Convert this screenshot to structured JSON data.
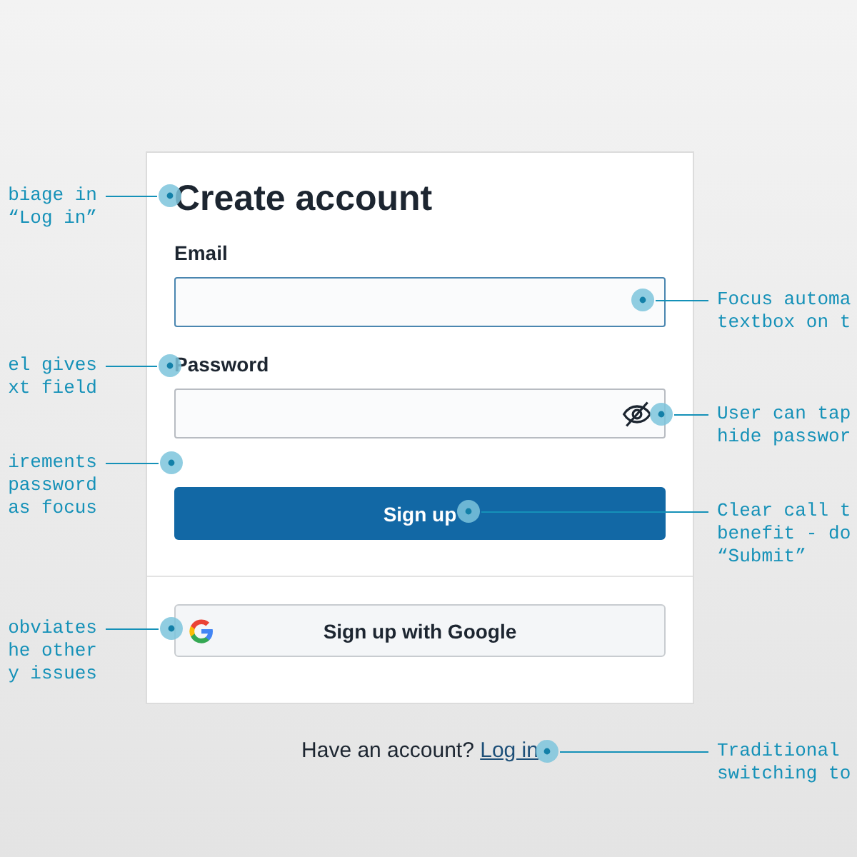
{
  "form": {
    "title": "Create account",
    "fields": [
      {
        "label": "Email",
        "kind": "text",
        "focused": true
      },
      {
        "label": "Password",
        "kind": "password",
        "focused": false
      }
    ],
    "submit": "Sign up",
    "google_button": "Sign up with Google"
  },
  "footer": {
    "text": "Have an account?",
    "link": "Log in"
  },
  "annotations": [
    {
      "kind": "left",
      "text": "biage in\n“Log in”"
    },
    {
      "kind": "left",
      "text": "el gives\nxt field"
    },
    {
      "kind": "left",
      "text": "irements\npassword\nas focus"
    },
    {
      "kind": "left",
      "text": "obviates\nhe other\ny issues"
    },
    {
      "kind": "right",
      "text": "Focus automa\ntextbox on t"
    },
    {
      "kind": "right",
      "text": "User can tap\nhide passwor"
    },
    {
      "kind": "right",
      "text": "Clear call t\nbenefit - do\n“Submit”"
    },
    {
      "kind": "right",
      "text": "Traditional\nswitching to"
    }
  ]
}
